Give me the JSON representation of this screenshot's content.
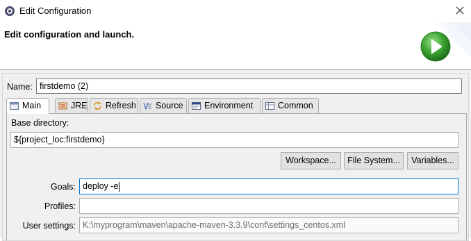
{
  "window": {
    "title": "Edit Configuration"
  },
  "banner": {
    "title": "Edit configuration and launch."
  },
  "name": {
    "label": "Name:",
    "value": "firstdemo (2)"
  },
  "tabs": [
    {
      "label": "Main",
      "icon": "main-tab-icon",
      "active": true
    },
    {
      "label": "JRE",
      "icon": "jre-icon"
    },
    {
      "label": "Refresh",
      "icon": "refresh-icon"
    },
    {
      "label": "Source",
      "icon": "source-icon"
    },
    {
      "label": "Environment",
      "icon": "environment-icon"
    },
    {
      "label": "Common",
      "icon": "common-icon"
    }
  ],
  "main": {
    "base_dir_label": "Base directory:",
    "base_dir_value": "${project_loc:firstdemo}",
    "buttons": {
      "workspace": "Workspace...",
      "file_system": "File System...",
      "variables": "Variables..."
    },
    "goals_label": "Goals:",
    "goals_value": "deploy -e",
    "profiles_label": "Profiles:",
    "profiles_value": "",
    "user_settings_label": "User settings:",
    "user_settings_value": "K:\\myprogram\\maven\\apache-maven-3.3.9\\conf\\settings_centos.xml"
  },
  "colors": {
    "focus_border": "#0078d7",
    "launch_green": "#3fa535"
  }
}
